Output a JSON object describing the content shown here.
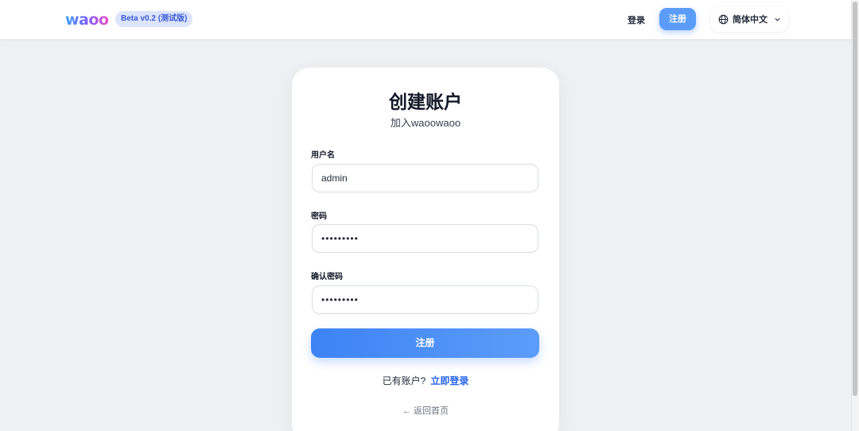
{
  "header": {
    "logo": "waoo",
    "badge": "Beta v0.2 (测试版)",
    "login": "登录",
    "register": "注册",
    "language": "简体中文"
  },
  "card": {
    "title": "创建账户",
    "subtitle": "加入waoowaoo",
    "username_label": "用户名",
    "username_value": "admin",
    "password_label": "密码",
    "password_value": "•••••••••",
    "confirm_label": "确认密码",
    "confirm_value": "•••••••••",
    "submit": "注册",
    "have_account": "已有账户?",
    "login_now": "立即登录",
    "back_home": "← 返回首页"
  },
  "colors": {
    "accent": "#3d83f6",
    "link": "#2563eb",
    "background": "#eef0f3"
  },
  "icons": [
    "globe-icon",
    "chevron-down-icon"
  ]
}
